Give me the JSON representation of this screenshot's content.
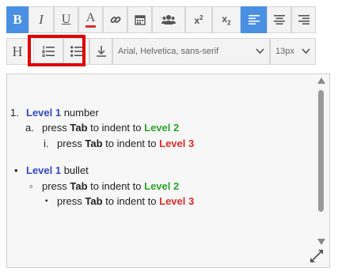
{
  "toolbar": {
    "row1": [
      {
        "name": "bold-button",
        "label": "B",
        "active": true
      },
      {
        "name": "italic-button",
        "label": "I"
      },
      {
        "name": "underline-button",
        "label": "U"
      },
      {
        "name": "text-color-button",
        "label": "A"
      },
      {
        "name": "link-button",
        "icon": "link-icon"
      },
      {
        "name": "insert-date-button",
        "icon": "calendar-icon"
      },
      {
        "name": "mention-button",
        "icon": "users-icon"
      },
      {
        "name": "superscript-button",
        "label": "x",
        "sup": "2"
      },
      {
        "name": "subscript-button",
        "label": "x",
        "sub": "2"
      },
      {
        "name": "align-left-button",
        "icon": "align-left-icon",
        "active": true
      },
      {
        "name": "align-center-button",
        "icon": "align-center-icon"
      },
      {
        "name": "align-right-button",
        "icon": "align-right-icon"
      }
    ],
    "heading_label": "H",
    "font_family_value": "Arial, Helvetica, sans-serif",
    "font_size_value": "13px"
  },
  "editor": {
    "ordered": {
      "l1_marker": "1.",
      "l1_level": "Level 1",
      "l1_text": " number",
      "l2_marker": "a.",
      "l2_prefix": "press ",
      "l2_key": "Tab",
      "l2_mid": " to indent to ",
      "l2_level": "Level 2",
      "l3_marker": "i.",
      "l3_prefix": "press ",
      "l3_key": "Tab",
      "l3_mid": " to indent to ",
      "l3_level": "Level 3"
    },
    "bulleted": {
      "l1_marker": "•",
      "l1_level": "Level 1",
      "l1_text": " bullet",
      "l2_marker": "◦",
      "l2_prefix": "press ",
      "l2_key": "Tab",
      "l2_mid": " to indent to ",
      "l2_level": "Level 2",
      "l3_marker": "▪",
      "l3_prefix": "press ",
      "l3_key": "Tab",
      "l3_mid": " to indent to ",
      "l3_level": "Level 3"
    }
  },
  "colors": {
    "accent": "#4a90e2",
    "level1": "#3348c8",
    "level2": "#2aa52a",
    "level3": "#e02b2b",
    "highlight": "#e00000"
  }
}
